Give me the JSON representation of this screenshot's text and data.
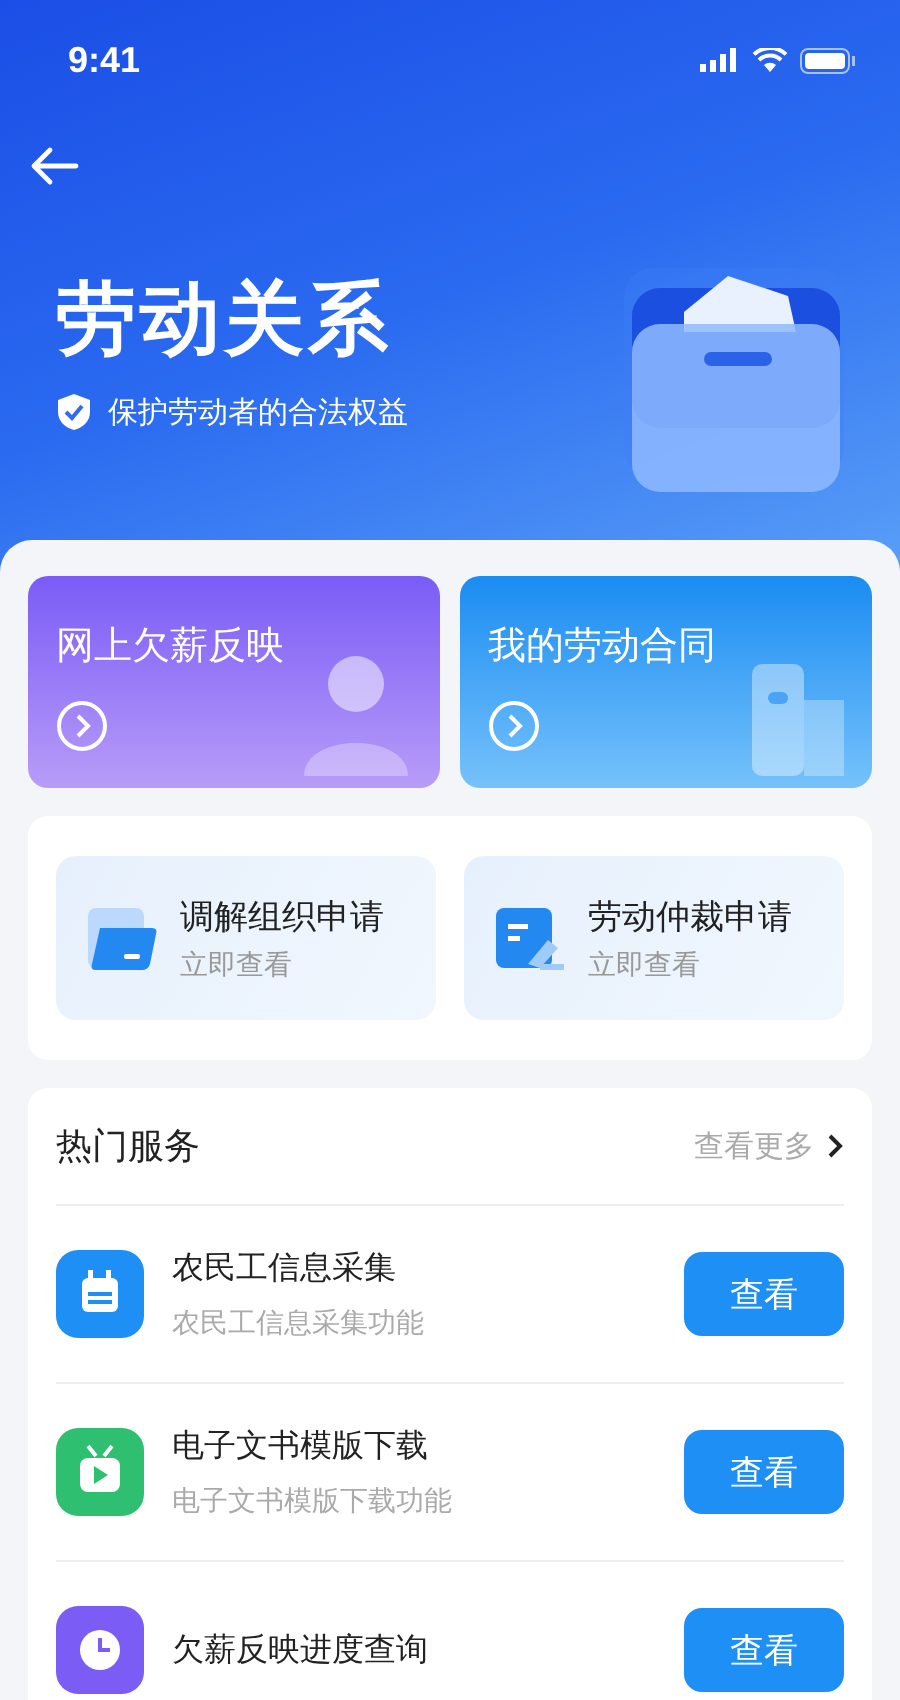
{
  "status_bar": {
    "time": "9:41"
  },
  "header": {
    "title": "劳动关系",
    "subtitle": "保护劳动者的合法权益"
  },
  "feature_cards": [
    {
      "kind": "purple",
      "title": "网上欠薪反映"
    },
    {
      "kind": "blue",
      "title": "我的劳动合同"
    }
  ],
  "applications": [
    {
      "kind": "folder",
      "title": "调解组织申请",
      "subtitle": "立即查看"
    },
    {
      "kind": "document",
      "title": "劳动仲裁申请",
      "subtitle": "立即查看"
    }
  ],
  "hot_services": {
    "title": "热门服务",
    "more": "查看更多",
    "items": [
      {
        "kind": "calendar",
        "color": "#1e8ff5",
        "title": "农民工信息采集",
        "subtitle": "农民工信息采集功能",
        "button": "查看"
      },
      {
        "kind": "video",
        "color": "#2fbf71",
        "title": "电子文书模版下载",
        "subtitle": "电子文书模版下载功能",
        "button": "查看"
      },
      {
        "kind": "clock",
        "color": "#7b5cf5",
        "title": "欠薪反映进度查询",
        "button": "查看"
      }
    ]
  }
}
